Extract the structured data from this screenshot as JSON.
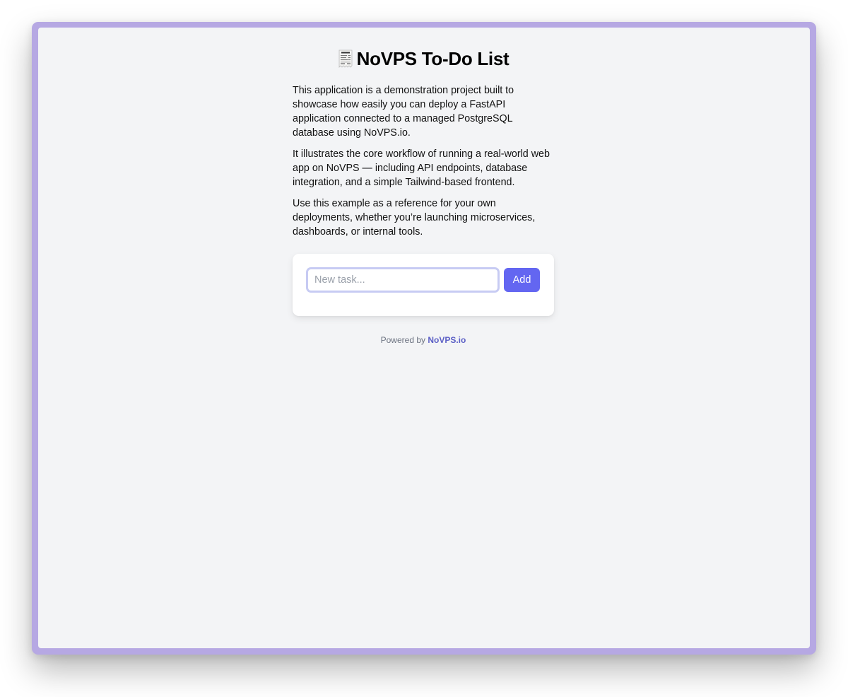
{
  "page": {
    "title": "NoVPS To-Do List",
    "title_icon": "receipt-icon"
  },
  "intro": [
    "This application is a demonstration project built to showcase how easily you can deploy a FastAPI application connected to a managed PostgreSQL database using NoVPS.io.",
    "It illustrates the core workflow of running a real-world web app on NoVPS — including API endpoints, database integration, and a simple Tailwind-based frontend.",
    "Use this example as a reference for your own deployments, whether you’re launching microservices, dashboards, or internal tools."
  ],
  "form": {
    "input_value": "",
    "input_placeholder": "New task...",
    "add_label": "Add"
  },
  "footer": {
    "prefix": "Powered by",
    "brand": "NoVPS.io"
  },
  "colors": {
    "accent": "#6366f1",
    "frame": "#b6a8e3",
    "background": "#f3f4f6",
    "brand_link": "#5c60c6"
  }
}
